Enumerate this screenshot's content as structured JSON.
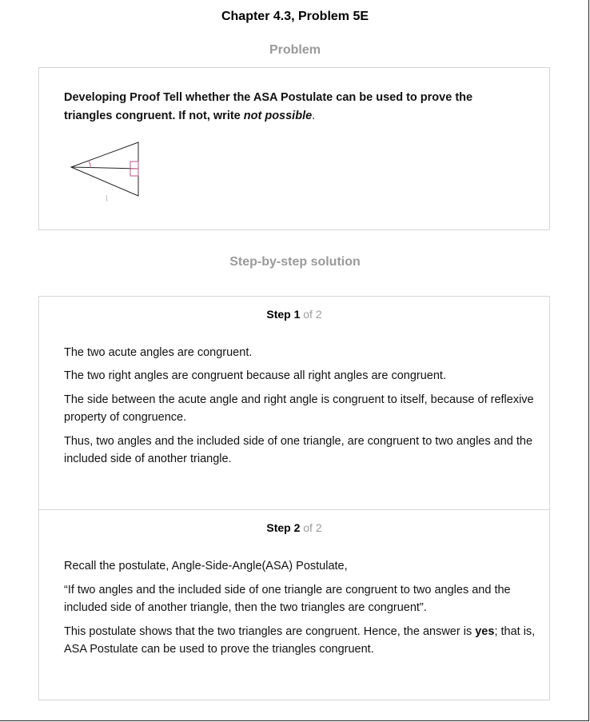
{
  "header": {
    "title": "Chapter 4.3, Problem 5E"
  },
  "problem": {
    "label": "Problem",
    "text_lead": "Developing Proof Tell whether the ASA Postulate can be used to prove the triangles congruent. If not, write ",
    "text_emph": "not possible",
    "text_end": "."
  },
  "solution": {
    "label": "Step-by-step solution",
    "steps": [
      {
        "step_word": "Step 1",
        "of_text": "of 2",
        "paragraphs": [
          "The two acute angles are congruent.",
          "The two right angles are congruent because all right angles are congruent.",
          "The side between the acute angle and right angle is congruent to itself, because of reflexive property of congruence.",
          "Thus, two angles and the included side of one triangle, are congruent to two angles and the included side of another triangle."
        ]
      },
      {
        "step_word": "Step 2",
        "of_text": "of 2",
        "paragraphs": [
          "Recall the postulate, Angle-Side-Angle(ASA) Postulate,",
          "“If two angles and the included side of one triangle are congruent to two angles and the included side of another triangle, then the two triangles are congruent”."
        ],
        "last_pre": "This postulate shows that the two triangles are congruent. Hence, the answer is ",
        "last_bold": "yes",
        "last_post": "; that is, ASA Postulate can be used to prove the triangles congruent."
      }
    ]
  }
}
